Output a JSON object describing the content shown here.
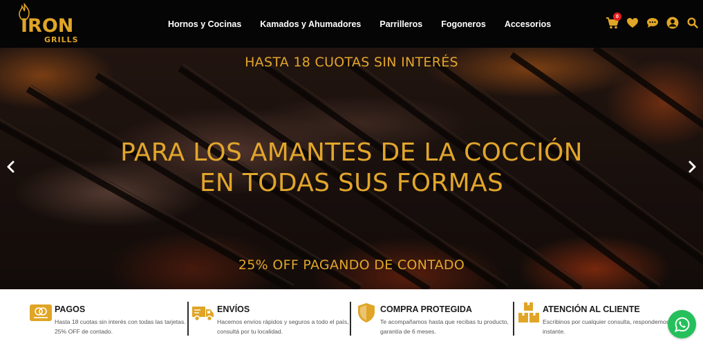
{
  "brand": {
    "name_line1": "IRON",
    "name_line2": "GRILLS",
    "accent_color": "#e0a526"
  },
  "nav": {
    "items": [
      {
        "label": "Hornos y Cocinas"
      },
      {
        "label": "Kamados y Ahumadores"
      },
      {
        "label": "Parrilleros"
      },
      {
        "label": "Fogoneros"
      },
      {
        "label": "Accesorios"
      }
    ]
  },
  "header_icons": {
    "cart": {
      "icon": "cart-icon",
      "count": "0"
    },
    "wishlist": {
      "icon": "heart-icon"
    },
    "chat": {
      "icon": "chat-bubble-icon"
    },
    "account": {
      "icon": "user-icon"
    },
    "search": {
      "icon": "search-icon"
    }
  },
  "hero": {
    "top_text": "HASTA 18 CUOTAS SIN INTERÉS",
    "title_line1": "PARA LOS AMANTES DE LA COCCIÓN",
    "title_line2": "EN TODAS SUS FORMAS",
    "bottom_text": "25% OFF PAGANDO DE CONTADO",
    "prev_icon": "chevron-left-icon",
    "next_icon": "chevron-right-icon"
  },
  "features": [
    {
      "icon": "credit-card-icon",
      "title": "PAGOS",
      "description": "Hasta 18 cuotas sin interés con todas las tarjetas. 25% OFF de contado."
    },
    {
      "icon": "delivery-truck-icon",
      "title": "ENVÍOS",
      "description": "Hacemos envíos rápidos y seguros a todo el país, consultá por tu localidad."
    },
    {
      "icon": "shield-icon",
      "title": "COMPRA PROTEGIDA",
      "description": "Te acompañamos hasta que recibas tu producto, garantía de 6 meses."
    },
    {
      "icon": "boxes-icon",
      "title": "ATENCIÓN AL CLIENTE",
      "description": "Escribinos por cualquier consulta, respondemos al instante."
    }
  ],
  "whatsapp": {
    "icon": "whatsapp-icon",
    "color": "#25c05b"
  }
}
